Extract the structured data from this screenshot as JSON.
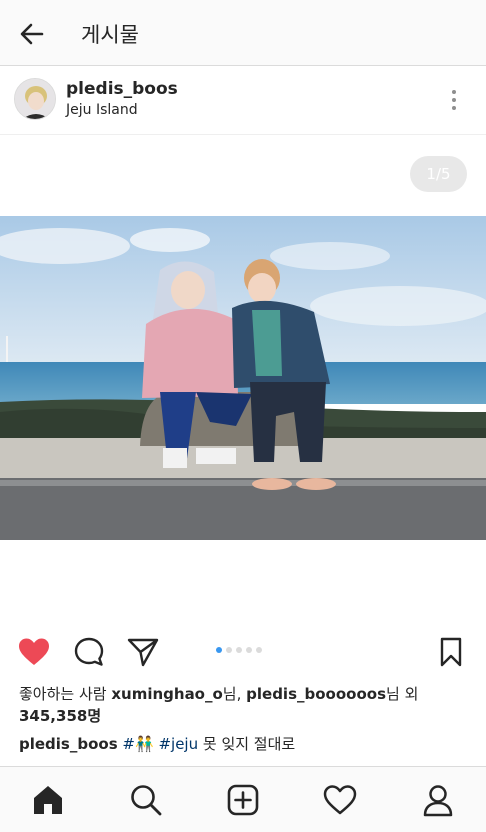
{
  "topbar": {
    "title": "게시물"
  },
  "post": {
    "username": "pledis_boos",
    "location": "Jeju Island",
    "counter": "1/5",
    "carousel": {
      "current": 1,
      "total": 5
    }
  },
  "likes": {
    "prefix": "좋아하는 사람 ",
    "user1": "xuminghao_o",
    "mid": "님, ",
    "user2": "pledis_boooooos",
    "suffix": "님 외",
    "count": "345,358명"
  },
  "caption": {
    "user": "pledis_boos",
    "tag1": "#👬",
    "tag2": "#jeju",
    "text": "못 잊지 절대로"
  },
  "colors": {
    "like_red": "#ed4956",
    "hashtag": "#003569",
    "active_dot": "#3897f0"
  },
  "icons": {
    "back": "arrow-left-icon",
    "more": "more-vertical-icon",
    "like": "heart-filled-icon",
    "comment": "comment-icon",
    "share": "paper-plane-icon",
    "save": "bookmark-icon",
    "tabs": [
      "home-icon",
      "search-icon",
      "add-post-icon",
      "activity-heart-icon",
      "profile-icon"
    ]
  }
}
